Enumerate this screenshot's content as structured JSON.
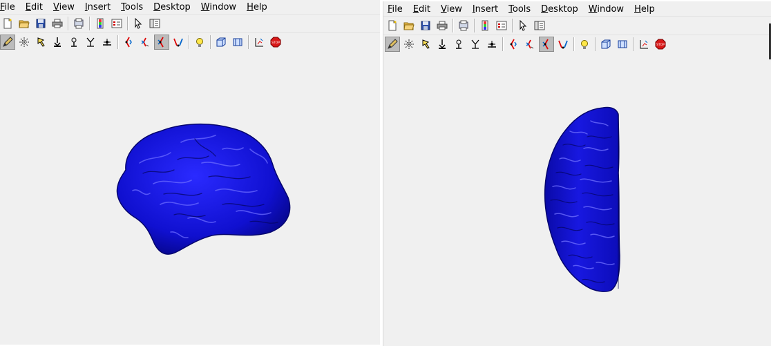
{
  "left_window": {
    "menu": [
      "File",
      "Edit",
      "View",
      "Insert",
      "Tools",
      "Desktop",
      "Window",
      "Help"
    ],
    "pressed_tool": "rotate-3d",
    "view": "side"
  },
  "right_window": {
    "menu": [
      "File",
      "Edit",
      "View",
      "Insert",
      "Tools",
      "Desktop",
      "Window",
      "Help"
    ],
    "pressed_tool": "rotate-3d",
    "view": "top"
  },
  "colors": {
    "surface": "#1414d8",
    "surface_dark": "#08087a",
    "surface_highlight": "#8a8aff",
    "window_bg": "#f0f0f0"
  },
  "toolbar1_icons": [
    "new-file-icon",
    "open-folder-icon",
    "save-icon",
    "print-icon",
    "print-preview-icon",
    "colorbar-icon",
    "legend-icon",
    "pointer-arrow-icon",
    "property-editor-icon"
  ],
  "toolbar2_icons": [
    "edit-plot-icon",
    "zoom-icon",
    "data-cursor-icon",
    "pan-icon",
    "rotate-icon",
    "align-icon",
    "camera-orbit-icon",
    "camera-move-icon",
    "rotate-3d-icon",
    "camera-roll-icon",
    "light-icon",
    "projection-cube-icon",
    "projection-flat-icon",
    "scene-axes-icon",
    "stop-icon"
  ]
}
